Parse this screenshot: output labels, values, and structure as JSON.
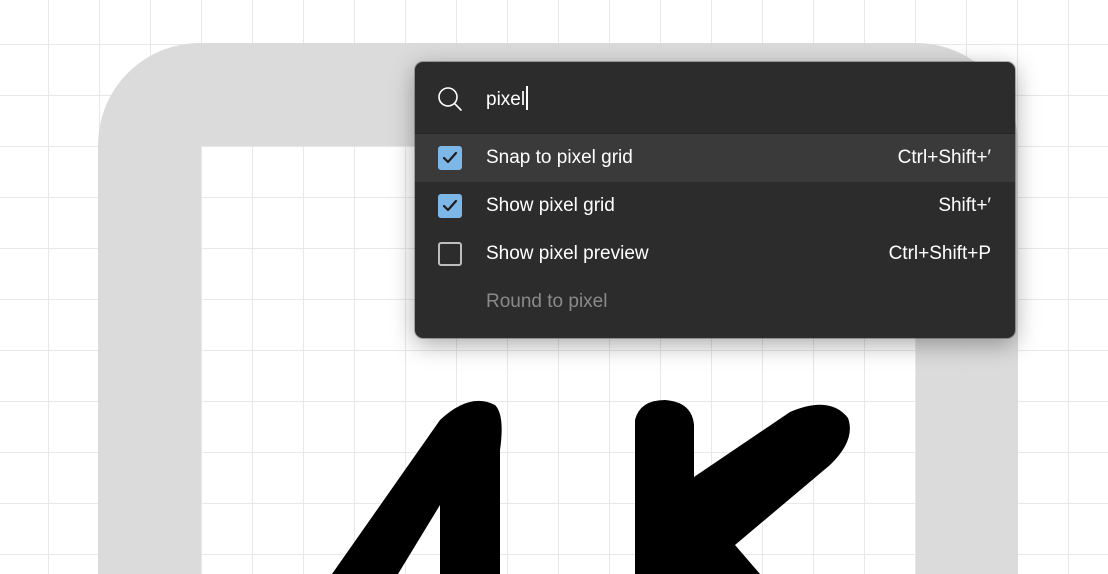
{
  "canvas": {
    "grid_color": "#e8e8e8",
    "frame_color": "#d9d9d9",
    "artwork_color": "#000000"
  },
  "command_palette": {
    "search": {
      "icon": "search-icon",
      "value": "pixel",
      "placeholder": ""
    },
    "items": [
      {
        "label": "Snap to pixel grid",
        "shortcut": "Ctrl+Shift+′",
        "checked": true,
        "highlighted": true,
        "enabled": true
      },
      {
        "label": "Show pixel grid",
        "shortcut": "Shift+′",
        "checked": true,
        "highlighted": false,
        "enabled": true
      },
      {
        "label": "Show pixel preview",
        "shortcut": "Ctrl+Shift+P",
        "checked": false,
        "highlighted": false,
        "enabled": true
      },
      {
        "label": "Round to pixel",
        "shortcut": "",
        "checked": null,
        "highlighted": false,
        "enabled": false
      }
    ],
    "colors": {
      "background": "#2c2c2c",
      "highlight": "#3a3a3a",
      "checkbox_checked": "#7cb7e8",
      "disabled_text": "#8a8a8a"
    }
  }
}
